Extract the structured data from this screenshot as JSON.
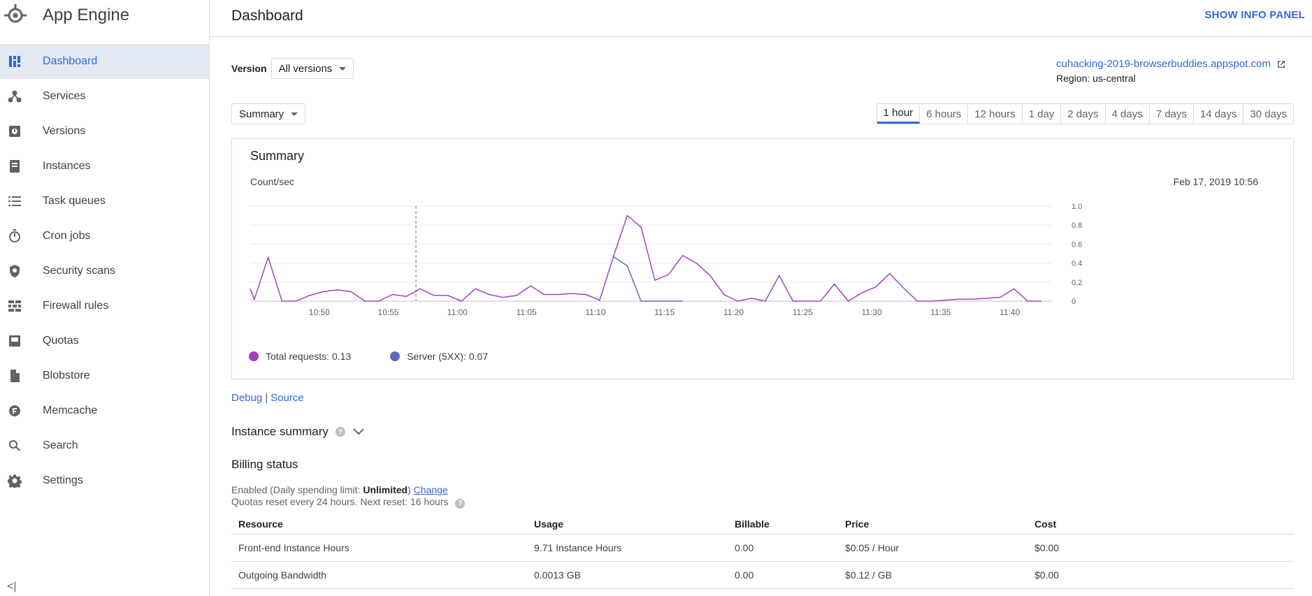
{
  "app": {
    "title": "App Engine",
    "logo_icon": "app-engine-logo-icon"
  },
  "sidebar": {
    "items": [
      {
        "label": "Dashboard",
        "icon": "dashboard-icon",
        "active": true
      },
      {
        "label": "Services",
        "icon": "services-icon"
      },
      {
        "label": "Versions",
        "icon": "versions-icon"
      },
      {
        "label": "Instances",
        "icon": "instances-icon"
      },
      {
        "label": "Task queues",
        "icon": "task-queues-icon"
      },
      {
        "label": "Cron jobs",
        "icon": "cron-jobs-icon"
      },
      {
        "label": "Security scans",
        "icon": "security-scans-icon"
      },
      {
        "label": "Firewall rules",
        "icon": "firewall-rules-icon"
      },
      {
        "label": "Quotas",
        "icon": "quotas-icon"
      },
      {
        "label": "Blobstore",
        "icon": "blobstore-icon"
      },
      {
        "label": "Memcache",
        "icon": "memcache-icon"
      },
      {
        "label": "Search",
        "icon": "search-icon"
      },
      {
        "label": "Settings",
        "icon": "settings-icon"
      }
    ],
    "collapse_glyph": "<|"
  },
  "header": {
    "title": "Dashboard",
    "info_panel": "SHOW INFO PANEL"
  },
  "version": {
    "label": "Version",
    "selected": "All versions"
  },
  "app_link": {
    "url_text": "cuhacking-2019-browserbuddies.appspot.com",
    "region": "Region: us-central"
  },
  "view_select": {
    "selected": "Summary"
  },
  "time_ranges": [
    "1 hour",
    "6 hours",
    "12 hours",
    "1 day",
    "2 days",
    "4 days",
    "7 days",
    "14 days",
    "30 days"
  ],
  "active_range": "1 hour",
  "chart": {
    "title": "Summary",
    "unit": "Count/sec",
    "date": "Feb 17, 2019 10:56",
    "legend": [
      {
        "label": "Total requests: 0.13",
        "color": "#a142c4"
      },
      {
        "label": "Server (5XX): 0.07",
        "color": "#5c6bc0"
      }
    ]
  },
  "chart_data": {
    "type": "line",
    "xlabel": "",
    "ylabel": "Count/sec",
    "ylim": [
      0,
      1.0
    ],
    "yticks": [
      "1.0",
      "0.8",
      "0.6",
      "0.4",
      "0.2",
      "0"
    ],
    "xticks": [
      "10:50",
      "10:55",
      "11:00",
      "11:05",
      "11:10",
      "11:15",
      "11:20",
      "11:25",
      "11:30",
      "11:35",
      "11:40"
    ],
    "xrange_minutes": [
      45.0,
      102.7
    ],
    "cursor_minute": 57,
    "series": [
      {
        "name": "Total requests",
        "color": "#a142c4",
        "x": [
          45.0,
          45.3,
          46.3,
          47.3,
          48.3,
          49.3,
          50.3,
          51.3,
          52.3,
          53.3,
          54.3,
          55.3,
          56.3,
          57.3,
          58.3,
          59.3,
          60.3,
          61.3,
          62.3,
          63.3,
          64.3,
          65.3,
          66.3,
          67.3,
          68.3,
          69.3,
          70.3,
          71.3,
          72.3,
          73.3,
          74.3,
          75.3,
          76.3,
          77.3,
          78.3,
          79.3,
          80.3,
          81.3,
          82.3,
          83.3,
          84.3,
          85.3,
          86.3,
          87.3,
          88.3,
          89.3,
          90.3,
          91.3,
          92.3,
          93.3,
          94.3,
          95.3,
          96.3,
          97.3,
          98.3,
          99.3,
          100.3,
          101.3,
          102.3
        ],
        "y": [
          0.13,
          0.02,
          0.46,
          0.0,
          0.0,
          0.06,
          0.1,
          0.12,
          0.1,
          0.0,
          0.0,
          0.07,
          0.05,
          0.13,
          0.06,
          0.06,
          0.0,
          0.13,
          0.07,
          0.04,
          0.06,
          0.16,
          0.07,
          0.07,
          0.08,
          0.07,
          0.01,
          0.47,
          0.9,
          0.78,
          0.22,
          0.28,
          0.48,
          0.4,
          0.27,
          0.07,
          0.0,
          0.03,
          0.0,
          0.27,
          0.0,
          0.0,
          0.0,
          0.18,
          0.0,
          0.09,
          0.15,
          0.29,
          0.14,
          0.0,
          0.0,
          0.01,
          0.02,
          0.02,
          0.03,
          0.04,
          0.13,
          0.0,
          0.0
        ]
      },
      {
        "name": "Server (5XX)",
        "color": "#5c6bc0",
        "x": [
          71.3,
          72.3,
          73.3,
          74.3,
          75.3,
          76.3
        ],
        "y": [
          0.47,
          0.37,
          0.0,
          0.0,
          0.0,
          0.0
        ]
      }
    ]
  },
  "links": {
    "debug": "Debug",
    "separator": "|",
    "source": "Source"
  },
  "instance_summary": {
    "title": "Instance summary",
    "help": "?"
  },
  "billing": {
    "title": "Billing status",
    "line1_prefix": "Enabled (Daily spending limit: ",
    "line1_bold": "Unlimited",
    "line1_suffix": ") ",
    "change": "Change",
    "line2": "Quotas reset every 24 hours. Next reset: 16 hours",
    "help": "?",
    "columns": [
      "Resource",
      "Usage",
      "Billable",
      "Price",
      "Cost"
    ],
    "rows": [
      [
        "Front-end Instance Hours",
        "9.71 Instance Hours",
        "0.00",
        "$0.05 / Hour",
        "$0.00"
      ],
      [
        "Outgoing Bandwidth",
        "0.0013 GB",
        "0.00",
        "$0.12 / GB",
        "$0.00"
      ]
    ]
  }
}
